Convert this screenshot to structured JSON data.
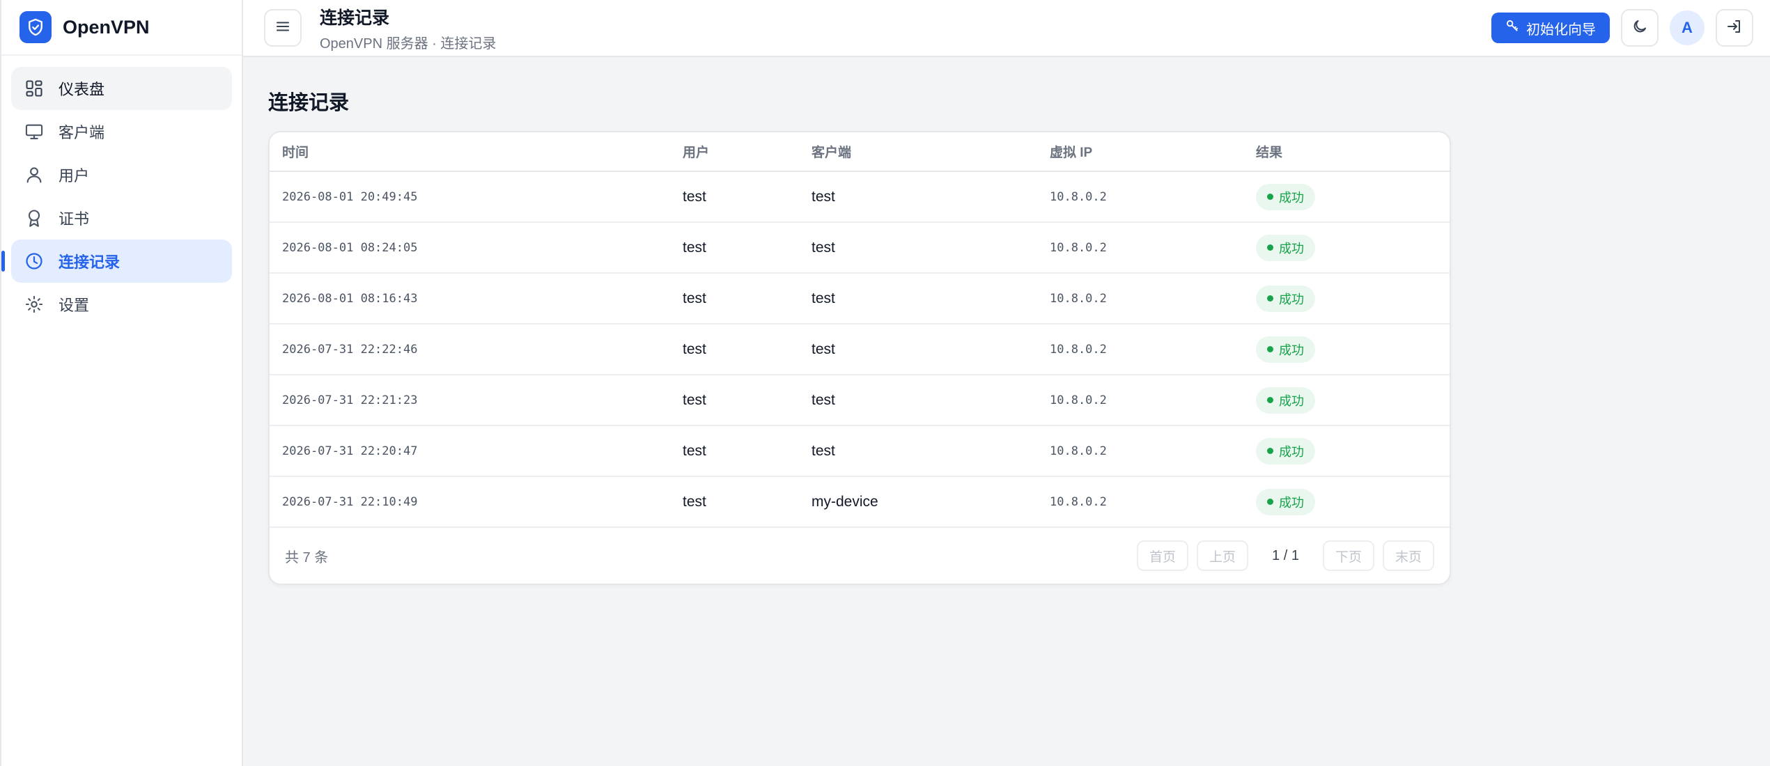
{
  "app": {
    "name": "OpenVPN"
  },
  "sidebar": {
    "items": [
      {
        "label": "仪表盘",
        "icon": "dashboard-icon"
      },
      {
        "label": "客户端",
        "icon": "monitor-icon"
      },
      {
        "label": "用户",
        "icon": "user-icon"
      },
      {
        "label": "证书",
        "icon": "award-icon"
      },
      {
        "label": "连接记录",
        "icon": "clock-icon",
        "active": true
      },
      {
        "label": "设置",
        "icon": "gear-icon"
      }
    ]
  },
  "header": {
    "title": "连接记录",
    "breadcrumb": "OpenVPN 服务器 · 连接记录",
    "wizard_label": "初始化向导",
    "avatar_initial": "A"
  },
  "page": {
    "heading": "连接记录"
  },
  "table": {
    "columns": [
      "时间",
      "用户",
      "客户端",
      "虚拟 IP",
      "结果"
    ],
    "rows": [
      {
        "time": "2026-08-01 20:49:45",
        "user": "test",
        "client": "test",
        "ip": "10.8.0.2",
        "result": "成功"
      },
      {
        "time": "2026-08-01 08:24:05",
        "user": "test",
        "client": "test",
        "ip": "10.8.0.2",
        "result": "成功"
      },
      {
        "time": "2026-08-01 08:16:43",
        "user": "test",
        "client": "test",
        "ip": "10.8.0.2",
        "result": "成功"
      },
      {
        "time": "2026-07-31 22:22:46",
        "user": "test",
        "client": "test",
        "ip": "10.8.0.2",
        "result": "成功"
      },
      {
        "time": "2026-07-31 22:21:23",
        "user": "test",
        "client": "test",
        "ip": "10.8.0.2",
        "result": "成功"
      },
      {
        "time": "2026-07-31 22:20:47",
        "user": "test",
        "client": "test",
        "ip": "10.8.0.2",
        "result": "成功"
      },
      {
        "time": "2026-07-31 22:10:49",
        "user": "test",
        "client": "my-device",
        "ip": "10.8.0.2",
        "result": "成功"
      }
    ]
  },
  "footer": {
    "total": "共 7 条",
    "first": "首页",
    "prev": "上页",
    "page_info": "1 / 1",
    "next": "下页",
    "last": "末页"
  },
  "colors": {
    "accent": "#2563eb",
    "success": "#16a34a",
    "success_bg": "#e9f7ef"
  }
}
